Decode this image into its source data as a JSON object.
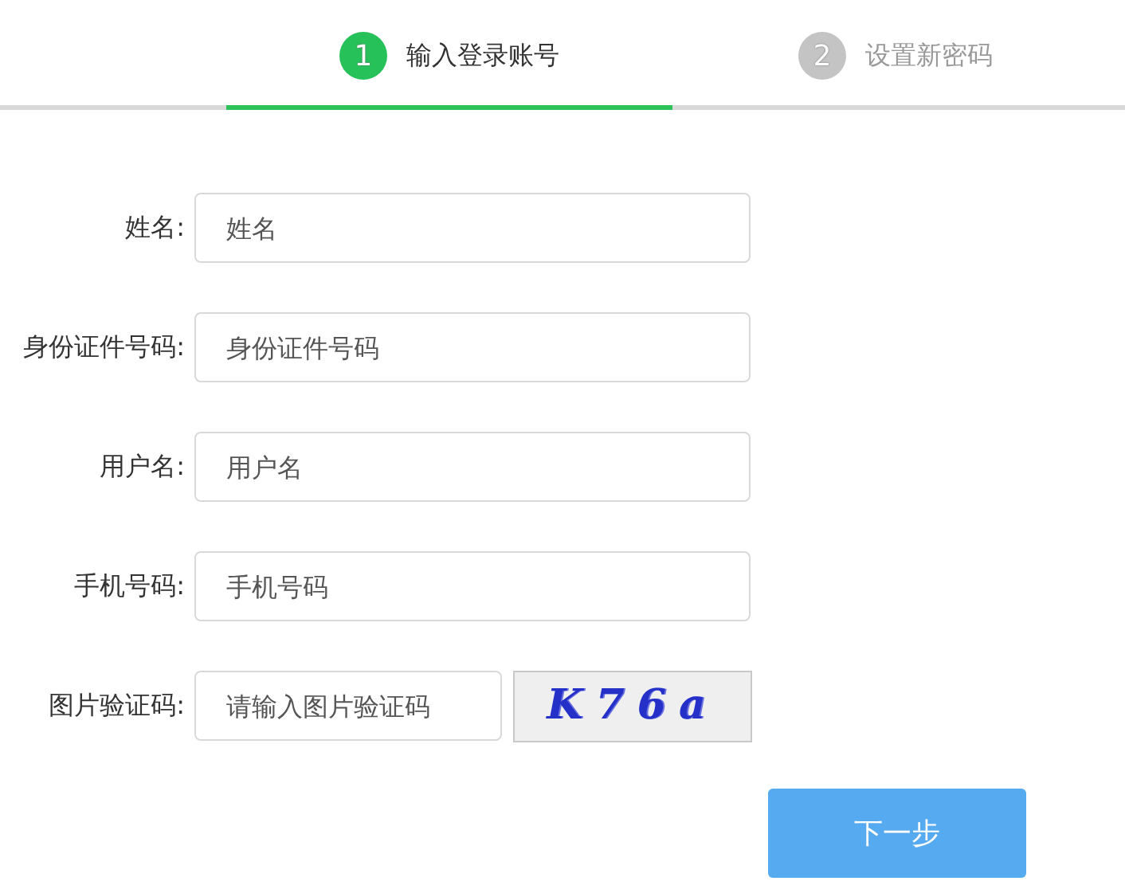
{
  "steps": [
    {
      "number": "1",
      "label": "输入登录账号",
      "selected": true
    },
    {
      "number": "2",
      "label": "设置新密码",
      "selected": false
    }
  ],
  "fields": [
    {
      "label": "姓名:",
      "placeholder": "姓名"
    },
    {
      "label": "身份证件号码:",
      "placeholder": "身份证件号码"
    },
    {
      "label": "用户名:",
      "placeholder": "用户名"
    },
    {
      "label": "手机号码:",
      "placeholder": "手机号码"
    },
    {
      "label": "图片验证码:",
      "placeholder": "请输入图片验证码",
      "kind": "captcha",
      "captcha": "K76a"
    }
  ],
  "button": "下一步"
}
